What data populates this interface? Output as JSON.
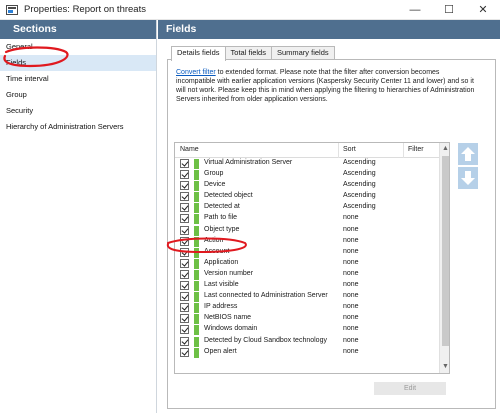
{
  "window": {
    "title": "Properties: Report on threats",
    "minimize": "—",
    "maximize": "☐",
    "close": "✕"
  },
  "sidebar": {
    "header": "Sections",
    "items": [
      {
        "label": "General",
        "selected": false
      },
      {
        "label": "Fields",
        "selected": true
      },
      {
        "label": "Time interval",
        "selected": false
      },
      {
        "label": "Group",
        "selected": false
      },
      {
        "label": "Security",
        "selected": false
      },
      {
        "label": "Hierarchy of Administration Servers",
        "selected": false
      }
    ]
  },
  "main": {
    "header": "Fields",
    "tabs": [
      {
        "label": "Details fields",
        "active": true
      },
      {
        "label": "Total fields",
        "active": false
      },
      {
        "label": "Summary fields",
        "active": false
      }
    ],
    "info": {
      "link": "Convert filter",
      "text": " to extended format. Please note that the filter after conversion becomes incompatible with earlier application versions (Kaspersky Security Center 11 and lower) and so it will not work. Please keep this in mind when applying the filtering to hierarchies of Administration Servers inherited from older application versions."
    },
    "table": {
      "columns": {
        "name": "Name",
        "sort": "Sort",
        "filter": "Filter"
      },
      "rows": [
        {
          "name": "Virtual Administration Server",
          "sort": "Ascending"
        },
        {
          "name": "Group",
          "sort": "Ascending"
        },
        {
          "name": "Device",
          "sort": "Ascending"
        },
        {
          "name": "Detected object",
          "sort": "Ascending"
        },
        {
          "name": "Detected at",
          "sort": "Ascending"
        },
        {
          "name": "Path to file",
          "sort": "none"
        },
        {
          "name": "Object type",
          "sort": "none"
        },
        {
          "name": "Action",
          "sort": "none"
        },
        {
          "name": "Account",
          "sort": "none"
        },
        {
          "name": "Application",
          "sort": "none"
        },
        {
          "name": "Version number",
          "sort": "none"
        },
        {
          "name": "Last visible",
          "sort": "none"
        },
        {
          "name": "Last connected to Administration Server",
          "sort": "none"
        },
        {
          "name": "IP address",
          "sort": "none"
        },
        {
          "name": "NetBIOS name",
          "sort": "none"
        },
        {
          "name": "Windows domain",
          "sort": "none"
        },
        {
          "name": "Detected by Cloud Sandbox technology",
          "sort": "none"
        },
        {
          "name": "Open alert",
          "sort": "none"
        }
      ]
    },
    "edit_button": "Edit"
  },
  "colors": {
    "header_bg": "#4f6f8f",
    "selected_bg": "#d9e8f6",
    "field_marker": "#6dc045",
    "annotation": "#e0191f"
  }
}
